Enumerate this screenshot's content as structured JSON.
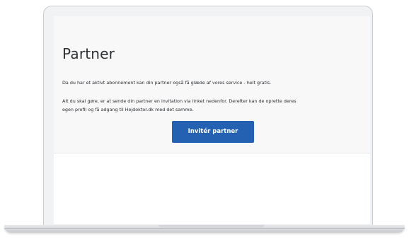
{
  "page": {
    "title": "Partner",
    "paragraph_1": "Da du har et aktivt abonnement kan din partner også få glæde af vores service - helt gratis.",
    "paragraph_2_line_1": "Alt du skal gøre, er at sende din partner en invitation via linket nedenfor. Derefter kan de oprette deres",
    "paragraph_2_line_2": "egen profil og få adgang til Hejdoktor.dk med det samme.",
    "invite_button_label": "Invitér partner"
  },
  "colors": {
    "accent": "#2561b3",
    "panel_background": "#f8f8f9",
    "text": "#2a2d30"
  }
}
